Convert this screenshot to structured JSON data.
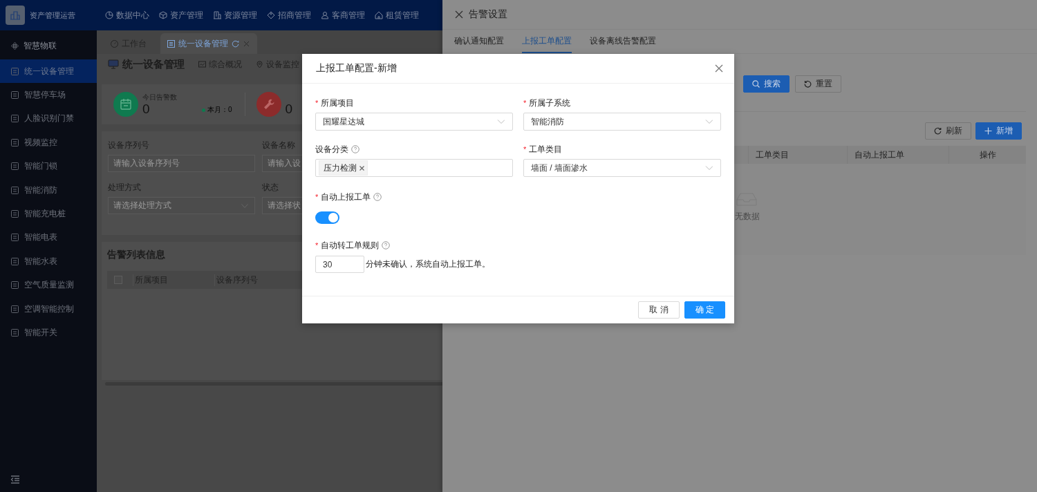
{
  "header": {
    "app_name": "资产管理运营",
    "nav": [
      {
        "label": "数据中心"
      },
      {
        "label": "资产管理"
      },
      {
        "label": "资源管理"
      },
      {
        "label": "招商管理"
      },
      {
        "label": "客商管理"
      },
      {
        "label": "租赁管理"
      }
    ]
  },
  "sidebar": {
    "group": "智慧物联",
    "items": [
      {
        "label": "统一设备管理",
        "selected": true
      },
      {
        "label": "智慧停车场",
        "selected": false
      },
      {
        "label": "人脸识别门禁",
        "selected": false
      },
      {
        "label": "视频监控",
        "selected": false
      },
      {
        "label": "智能门锁",
        "selected": false
      },
      {
        "label": "智能消防",
        "selected": false
      },
      {
        "label": "智能充电桩",
        "selected": false
      },
      {
        "label": "智能电表",
        "selected": false
      },
      {
        "label": "智能水表",
        "selected": false
      },
      {
        "label": "空气质量监测",
        "selected": false
      },
      {
        "label": "空调智能控制",
        "selected": false
      },
      {
        "label": "智能开关",
        "selected": false
      }
    ]
  },
  "tabs": [
    {
      "label": "工作台",
      "selected": false
    },
    {
      "label": "统一设备管理",
      "selected": true
    }
  ],
  "page": {
    "title": "统一设备管理",
    "subnav": [
      {
        "label": "综合概况"
      },
      {
        "label": "设备监控"
      }
    ]
  },
  "stats": [
    {
      "label": "今日告警数",
      "value": "0",
      "month": "本月：0",
      "color": "#0f7a4f"
    },
    {
      "value": "0",
      "color": "#8c2b2b"
    }
  ],
  "filters": [
    {
      "label": "设备序列号",
      "placeholder": "请输入设备序列号",
      "kind": "input"
    },
    {
      "label": "设备名称",
      "placeholder": "请输入设",
      "kind": "input"
    },
    {
      "label": "处理方式",
      "placeholder": "请选择处理方式",
      "kind": "select"
    },
    {
      "label": "状态",
      "placeholder": "请选择状",
      "kind": "input"
    }
  ],
  "alert_table": {
    "title": "告警列表信息",
    "checked": false,
    "columns": [
      "所属项目",
      "设备序列号"
    ]
  },
  "drawer": {
    "title": "告警设置",
    "tabs": [
      {
        "label": "确认通知配置",
        "selected": false
      },
      {
        "label": "上报工单配置",
        "selected": true
      },
      {
        "label": "设备离线告警配置",
        "selected": false
      }
    ],
    "search_buttons": [
      {
        "label": "搜索",
        "kind": "primary"
      },
      {
        "label": "重置",
        "kind": "default"
      }
    ],
    "toolbar_buttons": [
      {
        "label": "刷新",
        "kind": "default"
      },
      {
        "label": "新增",
        "kind": "primary"
      }
    ],
    "table": {
      "columns": [
        "工单类目",
        "自动上报工单",
        "操作"
      ],
      "empty_text": "无数据"
    }
  },
  "modal": {
    "title": "上报工单配置-新增",
    "fields": [
      {
        "required_mark": "*",
        "label": "所属项目",
        "kind": "select",
        "value": "国耀星达城"
      },
      {
        "required_mark": "*",
        "label": "所属子系统",
        "kind": "select",
        "value": "智能消防"
      },
      {
        "label": "设备分类",
        "help": true,
        "kind": "tags",
        "tags": [
          "压力检测"
        ]
      },
      {
        "required_mark": "*",
        "label": "工单类目",
        "kind": "select",
        "value": "墙面 / 墙面渗水"
      }
    ],
    "auto_report": {
      "required_mark": "*",
      "label": "自动上报工单",
      "help": true,
      "on": true
    },
    "rule": {
      "required_mark": "*",
      "label": "自动转工单规则",
      "help": true,
      "value": "30",
      "suffix": "分钟未确认，系统自动上报工单。"
    },
    "buttons": [
      {
        "label": "取 消",
        "kind": "default"
      },
      {
        "label": "确 定",
        "kind": "primary"
      }
    ]
  }
}
